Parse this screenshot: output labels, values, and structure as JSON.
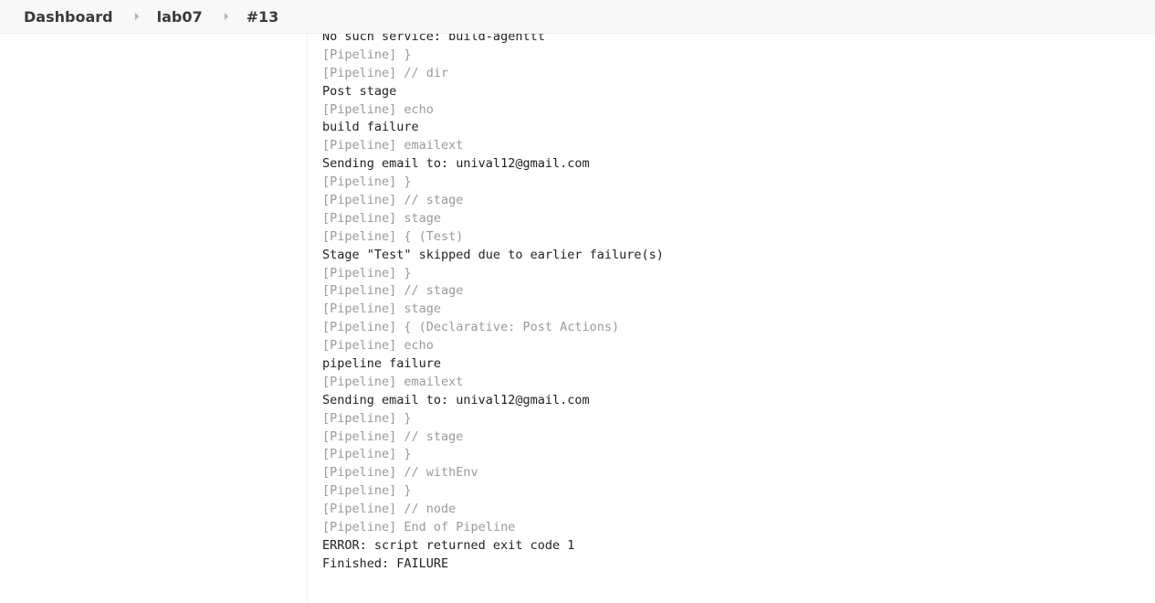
{
  "breadcrumb": {
    "items": [
      "Dashboard",
      "lab07",
      "#13"
    ]
  },
  "console": {
    "lines": [
      {
        "text": "No such service: build-agenttt",
        "dim": false
      },
      {
        "text": "[Pipeline] }",
        "dim": true
      },
      {
        "text": "[Pipeline] // dir",
        "dim": true
      },
      {
        "text": "Post stage",
        "dim": false
      },
      {
        "text": "[Pipeline] echo",
        "dim": true
      },
      {
        "text": "build failure",
        "dim": false
      },
      {
        "text": "[Pipeline] emailext",
        "dim": true
      },
      {
        "text": "Sending email to: unival12@gmail.com",
        "dim": false
      },
      {
        "text": "[Pipeline] }",
        "dim": true
      },
      {
        "text": "[Pipeline] // stage",
        "dim": true
      },
      {
        "text": "[Pipeline] stage",
        "dim": true
      },
      {
        "text": "[Pipeline] { (Test)",
        "dim": true
      },
      {
        "text": "Stage \"Test\" skipped due to earlier failure(s)",
        "dim": false
      },
      {
        "text": "[Pipeline] }",
        "dim": true
      },
      {
        "text": "[Pipeline] // stage",
        "dim": true
      },
      {
        "text": "[Pipeline] stage",
        "dim": true
      },
      {
        "text": "[Pipeline] { (Declarative: Post Actions)",
        "dim": true
      },
      {
        "text": "[Pipeline] echo",
        "dim": true
      },
      {
        "text": "pipeline failure",
        "dim": false
      },
      {
        "text": "[Pipeline] emailext",
        "dim": true
      },
      {
        "text": "Sending email to: unival12@gmail.com",
        "dim": false
      },
      {
        "text": "[Pipeline] }",
        "dim": true
      },
      {
        "text": "[Pipeline] // stage",
        "dim": true
      },
      {
        "text": "[Pipeline] }",
        "dim": true
      },
      {
        "text": "[Pipeline] // withEnv",
        "dim": true
      },
      {
        "text": "[Pipeline] }",
        "dim": true
      },
      {
        "text": "[Pipeline] // node",
        "dim": true
      },
      {
        "text": "[Pipeline] End of Pipeline",
        "dim": true
      },
      {
        "text": "ERROR: script returned exit code 1",
        "dim": false
      },
      {
        "text": "Finished: FAILURE",
        "dim": false
      }
    ]
  }
}
